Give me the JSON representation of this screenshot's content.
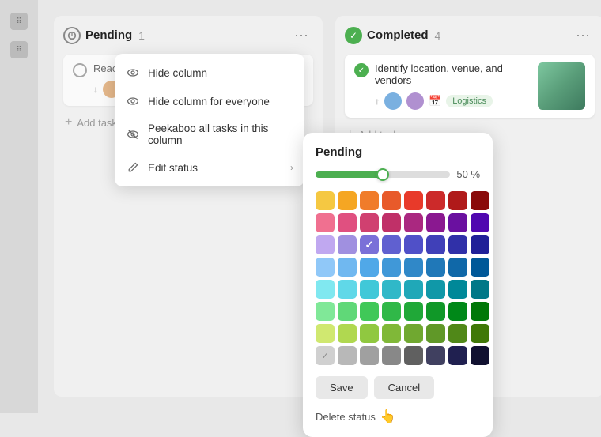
{
  "board": {
    "columns": [
      {
        "id": "pending",
        "title": "Pending",
        "count": 1,
        "iconType": "pending",
        "tasks": [
          {
            "text": "Reach... type &",
            "hasArrow": true
          }
        ]
      },
      {
        "id": "completed",
        "title": "Completed",
        "count": 4,
        "iconType": "completed",
        "tasks": [
          {
            "text": "Identify location, venue, and vendors",
            "tag": "Logistics",
            "hasImage": true
          }
        ]
      }
    ],
    "add_task_label": "Add task"
  },
  "dropdown_menu": {
    "items": [
      {
        "id": "hide-column",
        "label": "Hide column",
        "icon": "eye"
      },
      {
        "id": "hide-column-everyone",
        "label": "Hide column for everyone",
        "icon": "eye"
      },
      {
        "id": "peekaboo",
        "label": "Peekaboo all tasks in this column",
        "icon": "eye-slash"
      },
      {
        "id": "edit-status",
        "label": "Edit status",
        "icon": "pencil",
        "hasChevron": true
      }
    ]
  },
  "color_picker": {
    "title": "Pending",
    "slider_value": "50",
    "slider_unit": "%",
    "colors": [
      [
        "#f5c842",
        "#f5a623",
        "#f07c2a",
        "#e85a2a",
        "#e83a2a",
        "#cc2a2a",
        "#b01a1a"
      ],
      [
        "#e85a7a",
        "#d43a6a",
        "#c42a5a",
        "#b02060",
        "#9a1a70",
        "#7a1a8a",
        "#5a1a9a"
      ],
      [
        "#c0a0e8",
        "#9a80d8",
        "#7a70d8",
        "#5a60d8",
        "#4a50c8",
        "#3a40b8",
        "#2a30a8"
      ],
      [
        "#8ac0f0",
        "#6aacf0",
        "#4a9ce0",
        "#3a8cd0",
        "#2a7cc0",
        "#1a6cb0",
        "#0a5ca0"
      ],
      [
        "#8ad8f0",
        "#6ac8e8",
        "#4ab8d8",
        "#3aa8c8",
        "#2a98b8",
        "#1a88a8",
        "#0a7898"
      ],
      [
        "#80e898",
        "#60d878",
        "#40c858",
        "#30b848",
        "#20a838",
        "#109828",
        "#008818"
      ],
      [
        "#a0e870",
        "#80d850",
        "#60c840",
        "#50b838",
        "#40a830",
        "#309828",
        "#208818"
      ],
      [
        "#d0d0d0",
        "#b8b8b8",
        "#a0a0a0",
        "#888888",
        "#606060",
        "#404060",
        "#202050"
      ]
    ],
    "selected_color": "#7a70d8",
    "selected_row": 2,
    "selected_col": 2,
    "save_label": "Save",
    "cancel_label": "Cancel",
    "delete_label": "Delete status"
  },
  "nav": {
    "dots": [
      "•••",
      "•••"
    ]
  }
}
